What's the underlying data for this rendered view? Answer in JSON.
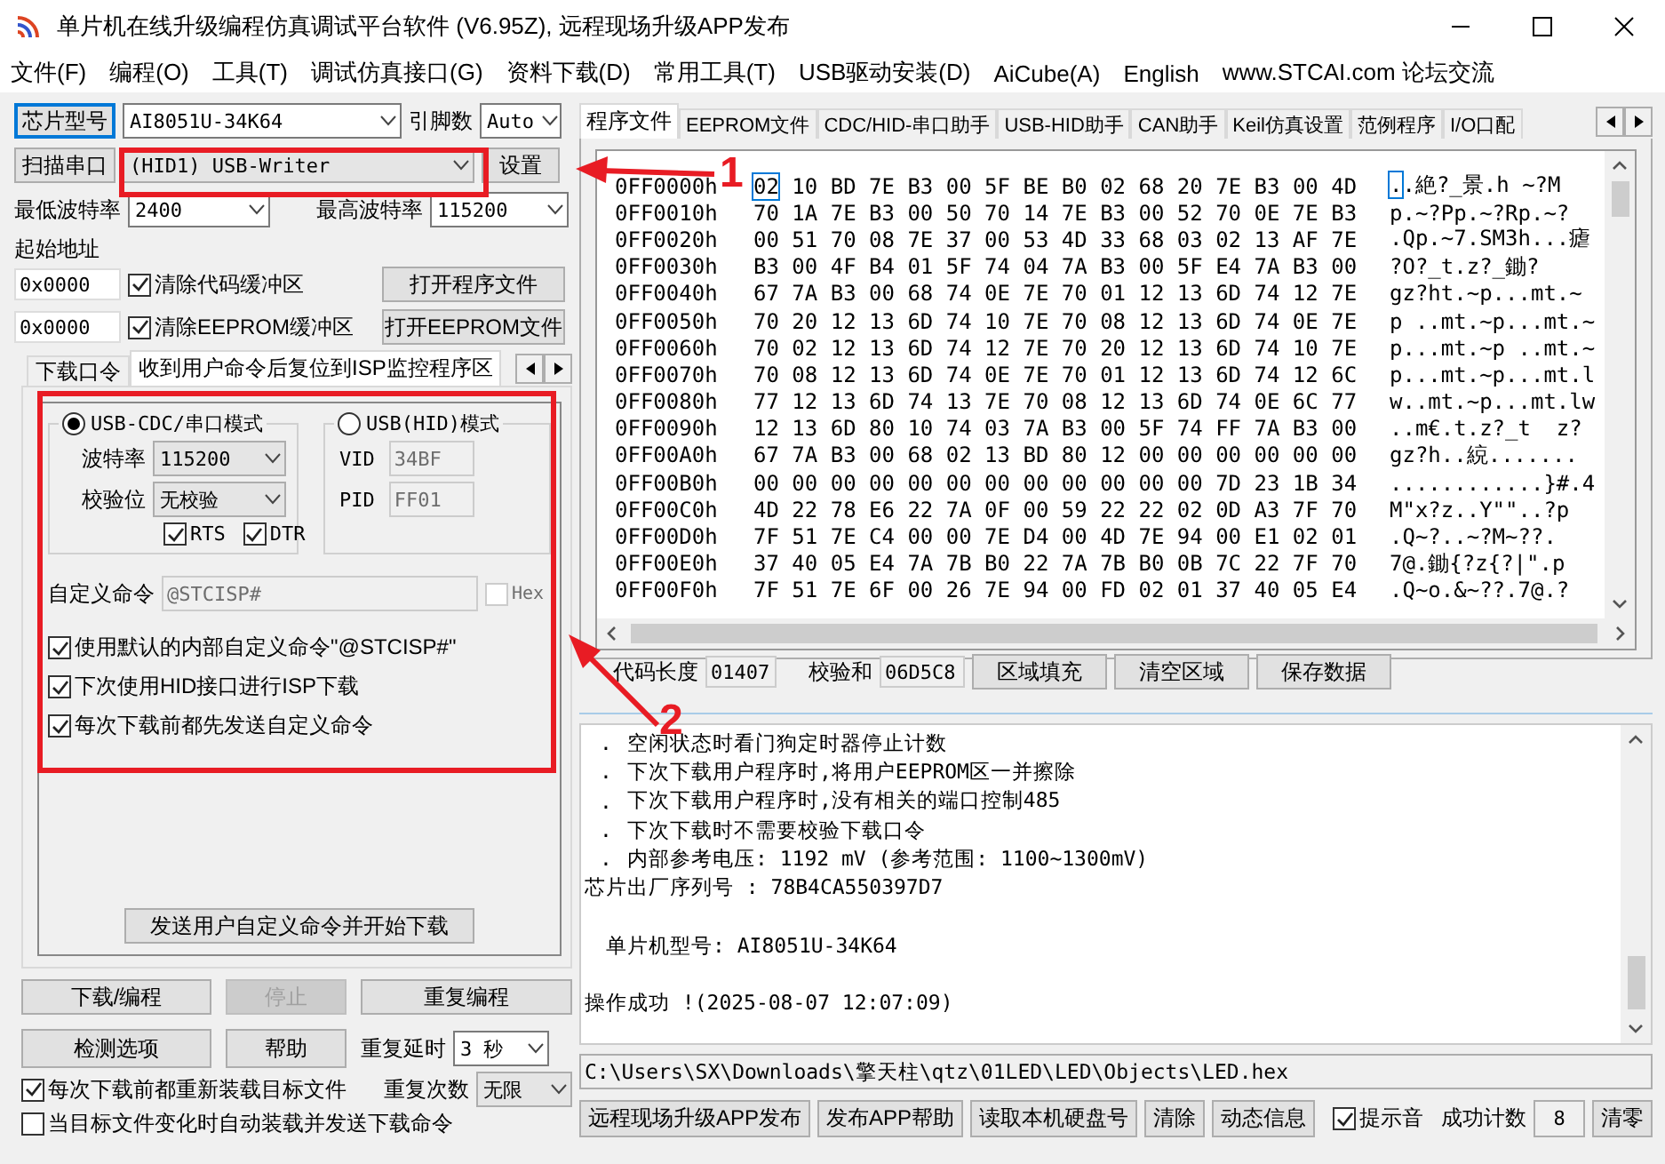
{
  "window": {
    "title": "单片机在线升级编程仿真调试平台软件 (V6.95Z), 远程现场升级APP发布"
  },
  "menu": [
    "文件(F)",
    "编程(O)",
    "工具(T)",
    "调试仿真接口(G)",
    "资料下载(D)",
    "常用工具(T)",
    "USB驱动安装(D)",
    "AiCube(A)",
    "English",
    "www.STCAI.com 论坛交流"
  ],
  "left": {
    "chip": {
      "button": "芯片型号",
      "focused": true,
      "value": "AI8051U-34K64",
      "pins_label": "引脚数",
      "pins_value": "Auto"
    },
    "port": {
      "button": "扫描串口",
      "value": "(HID1) USB-Writer",
      "settings_button": "设置"
    },
    "baud": {
      "min_label": "最低波特率",
      "min_value": "2400",
      "max_label": "最高波特率",
      "max_value": "115200"
    },
    "start_address": {
      "label": "起始地址",
      "rows": [
        {
          "value": "0x0000",
          "checkbox": "清除代码缓冲区",
          "checked": true,
          "button": "打开程序文件"
        },
        {
          "value": "0x0000",
          "checkbox": "清除EEPROM缓冲区",
          "checked": true,
          "button": "打开EEPROM文件"
        }
      ]
    },
    "tabs": [
      {
        "label": "下载口令",
        "selected": false
      },
      {
        "label": "收到用户命令后复位到ISP监控程序区",
        "selected": true
      }
    ],
    "panel": {
      "cdc": {
        "label": "USB-CDC/串口模式",
        "selected": true,
        "baud_label": "波特率",
        "baud_value": "115200",
        "parity_label": "校验位",
        "parity_value": "无校验",
        "rts": {
          "label": "RTS",
          "checked": true
        },
        "dtr": {
          "label": "DTR",
          "checked": true
        }
      },
      "hid": {
        "label": "USB(HID)模式",
        "selected": false,
        "disabled": true,
        "vid_label": "VID",
        "vid": "34BF",
        "pid_label": "PID",
        "pid": "FF01"
      },
      "command": {
        "label": "自定义命令",
        "value": "@STCISP#",
        "disabled": true,
        "hex_label": "Hex",
        "hex_checked": false
      },
      "options": [
        {
          "label": "使用默认的内部自定义命令\"@STCISP#\"",
          "checked": true
        },
        {
          "label": "下次使用HID接口进行ISP下载",
          "checked": true
        },
        {
          "label": "每次下载前都先发送自定义命令",
          "checked": true
        }
      ],
      "send_button": "发送用户自定义命令并开始下载"
    },
    "actions": [
      {
        "label": "下载/编程",
        "disabled": false
      },
      {
        "label": "停止",
        "disabled": true
      },
      {
        "label": "重复编程",
        "disabled": false
      },
      {
        "label": "检测选项",
        "disabled": false
      },
      {
        "label": "帮助",
        "disabled": false
      }
    ],
    "repeat": {
      "delay_label": "重复延时",
      "delay_value": "3 秒",
      "count_label": "重复次数",
      "count_value": "无限"
    },
    "bottom_options": [
      {
        "label": "每次下载前都重新装载目标文件",
        "checked": true
      },
      {
        "label": "当目标文件变化时自动装载并发送下载命令",
        "checked": false
      }
    ]
  },
  "right": {
    "tabs": [
      {
        "label": "程序文件",
        "selected": true
      },
      {
        "label": "EEPROM文件",
        "selected": false
      },
      {
        "label": "CDC/HID-串口助手",
        "selected": false
      },
      {
        "label": "USB-HID助手",
        "selected": false
      },
      {
        "label": "CAN助手",
        "selected": false
      },
      {
        "label": "Keil仿真设置",
        "selected": false
      },
      {
        "label": "范例程序",
        "selected": false
      },
      {
        "label": "I/O口配",
        "selected": false
      }
    ],
    "hex_rows": [
      {
        "address": "0FF0000h",
        "bytes": "02 10 BD 7E B3 00 5F BE B0 02 68 20 7E B3 00 4D",
        "ascii": "..絶?_景.h ~?M",
        "cursor": true
      },
      {
        "address": "0FF0010h",
        "bytes": "70 1A 7E B3 00 50 70 14 7E B3 00 52 70 0E 7E B3",
        "ascii": "p.~?Pp.~?Rp.~?",
        "cursor": false
      },
      {
        "address": "0FF0020h",
        "bytes": "00 51 70 08 7E 37 00 53 4D 33 68 03 02 13 AF 7E",
        "ascii": ".Qp.~7.SM3h...瘧",
        "cursor": false
      },
      {
        "address": "0FF0030h",
        "bytes": "B3 00 4F B4 01 5F 74 04 7A B3 00 5F E4 7A B3 00",
        "ascii": "?O?_t.z?_鋤?",
        "cursor": false
      },
      {
        "address": "0FF0040h",
        "bytes": "67 7A B3 00 68 74 0E 7E 70 01 12 13 6D 74 12 7E",
        "ascii": "gz?ht.~p...mt.~",
        "cursor": false
      },
      {
        "address": "0FF0050h",
        "bytes": "70 20 12 13 6D 74 10 7E 70 08 12 13 6D 74 0E 7E",
        "ascii": "p ..mt.~p...mt.~",
        "cursor": false
      },
      {
        "address": "0FF0060h",
        "bytes": "70 02 12 13 6D 74 12 7E 70 20 12 13 6D 74 10 7E",
        "ascii": "p...mt.~p ..mt.~",
        "cursor": false
      },
      {
        "address": "0FF0070h",
        "bytes": "70 08 12 13 6D 74 0E 7E 70 01 12 13 6D 74 12 6C",
        "ascii": "p...mt.~p...mt.l",
        "cursor": false
      },
      {
        "address": "0FF0080h",
        "bytes": "77 12 13 6D 74 13 7E 70 08 12 13 6D 74 0E 6C 77",
        "ascii": "w..mt.~p...mt.lw",
        "cursor": false
      },
      {
        "address": "0FF0090h",
        "bytes": "12 13 6D 80 10 74 03 7A B3 00 5F 74 FF 7A B3 00",
        "ascii": "..m€.t.z?_t  z?",
        "cursor": false
      },
      {
        "address": "0FF00A0h",
        "bytes": "67 7A B3 00 68 02 13 BD 80 12 00 00 00 00 00 00",
        "ascii": "gz?h..綂.......",
        "cursor": false
      },
      {
        "address": "0FF00B0h",
        "bytes": "00 00 00 00 00 00 00 00 00 00 00 00 7D 23 1B 34",
        "ascii": "............}#.4",
        "cursor": false
      },
      {
        "address": "0FF00C0h",
        "bytes": "4D 22 78 E6 22 7A 0F 00 59 22 22 02 0D A3 7F 70",
        "ascii": "M\"x?z..Y\"\"..?p",
        "cursor": false
      },
      {
        "address": "0FF00D0h",
        "bytes": "7F 51 7E C4 00 00 7E D4 00 4D 7E 94 00 E1 02 01",
        "ascii": ".Q~?..~?M~??.",
        "cursor": false
      },
      {
        "address": "0FF00E0h",
        "bytes": "37 40 05 E4 7A 7B B0 22 7A 7B B0 0B 7C 22 7F 70",
        "ascii": "7@.鋤{?z{?|\".p",
        "cursor": false
      },
      {
        "address": "0FF00F0h",
        "bytes": "7F 51 7E 6F 00 26 7E 94 00 FD 02 01 37 40 05 E4",
        "ascii": ".Q~o.&~??.7@.?",
        "cursor": false
      }
    ],
    "code_length_label": "代码长度",
    "code_length": "01407",
    "checksum_label": "校验和",
    "checksum": "06D5C8",
    "buttons": [
      "区域填充",
      "清空区域",
      "保存数据"
    ]
  },
  "log": [
    {
      "kind": "bullet",
      "bullet": ".",
      "text": "空闲状态时看门狗定时器停止计数",
      "gap_before": false
    },
    {
      "kind": "bullet",
      "bullet": ".",
      "text": "下次下载用户程序时,将用户EEPROM区一并擦除",
      "gap_before": false
    },
    {
      "kind": "bullet",
      "bullet": ".",
      "text": "下次下载用户程序时,没有相关的端口控制485",
      "gap_before": false
    },
    {
      "kind": "bullet",
      "bullet": ".",
      "text": "下次下载时不需要校验下载口令",
      "gap_before": false
    },
    {
      "kind": "bullet",
      "bullet": ".",
      "text": "内部参考电压: 1192 mV (参考范围: 1100~1300mV)",
      "gap_before": false
    },
    {
      "kind": "plain",
      "text": "芯片出厂序列号 : 78B4CA550397D7",
      "gap_before": false
    },
    {
      "kind": "indented",
      "text": "单片机型号: AI8051U-34K64",
      "gap_before": true
    },
    {
      "kind": "plain",
      "text": "操作成功 !(2025-08-07 12:07:09)",
      "gap_before": true
    }
  ],
  "file_path": "C:\\Users\\SX\\Downloads\\擎天柱\\qtz\\01LED\\LED\\Objects\\LED.hex",
  "footer": {
    "buttons": [
      "远程现场升级APP发布",
      "发布APP帮助",
      "读取本机硬盘号",
      "清除",
      "动态信息"
    ],
    "sound": {
      "label": "提示音",
      "checked": true
    },
    "count_label": "成功计数",
    "count": "8",
    "reset_button": "清零"
  },
  "annotations": [
    {
      "label": "1"
    },
    {
      "label": "2"
    }
  ]
}
